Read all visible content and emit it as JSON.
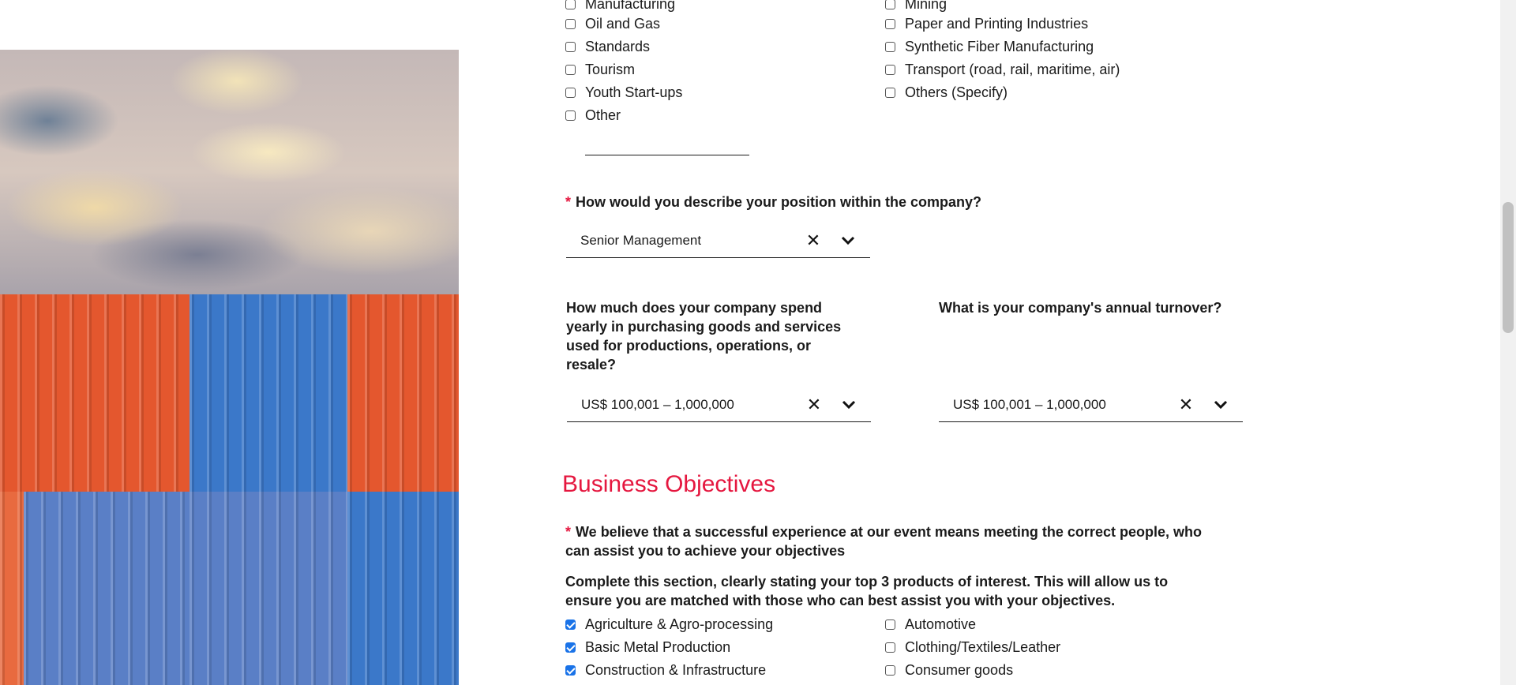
{
  "industries_top": {
    "left": [
      {
        "label": "Manufacturing",
        "checked": false
      },
      {
        "label": "Oil and Gas",
        "checked": false
      },
      {
        "label": "Standards",
        "checked": false
      },
      {
        "label": "Tourism",
        "checked": false
      },
      {
        "label": "Youth Start-ups",
        "checked": false
      },
      {
        "label": "Other",
        "checked": false
      }
    ],
    "right": [
      {
        "label": "Mining",
        "checked": false
      },
      {
        "label": "Paper and Printing Industries",
        "checked": false
      },
      {
        "label": "Synthetic Fiber Manufacturing",
        "checked": false
      },
      {
        "label": "Transport (road, rail, maritime, air)",
        "checked": false
      },
      {
        "label": "Others (Specify)",
        "checked": false
      }
    ],
    "other_value": ""
  },
  "position_question": {
    "required_mark": "*",
    "label": "How would you describe your position within the company?",
    "value": "Senior Management",
    "clear_label": "✕"
  },
  "spend_question": {
    "label": "How much does your company spend yearly in purchasing goods and services used for productions, operations, or resale?",
    "value": "US$ 100,001 – 1,000,000",
    "clear_label": "✕"
  },
  "turnover_question": {
    "label": "What is your company's annual turnover?",
    "value": "US$ 100,001 – 1,000,000",
    "clear_label": "✕"
  },
  "business_objectives": {
    "title": "Business Objectives",
    "required_mark": "*",
    "intro": "We believe that a successful experience at our event means meeting the correct people, who can assist you to achieve your objectives",
    "instruction": "Complete this section, clearly stating your top 3 products of interest. This will allow us to ensure you are matched with those who can best assist you with your objectives.",
    "products_left": [
      {
        "label": "Agriculture & Agro-processing",
        "checked": true
      },
      {
        "label": "Basic Metal Production",
        "checked": true
      },
      {
        "label": "Construction & Infrastructure",
        "checked": true
      }
    ],
    "products_right": [
      {
        "label": "Automotive",
        "checked": false
      },
      {
        "label": "Clothing/Textiles/Leather",
        "checked": false
      },
      {
        "label": "Consumer goods",
        "checked": false
      }
    ]
  },
  "colors": {
    "accent": "#e5173f",
    "checkbox_checked": "#1a73e8"
  }
}
